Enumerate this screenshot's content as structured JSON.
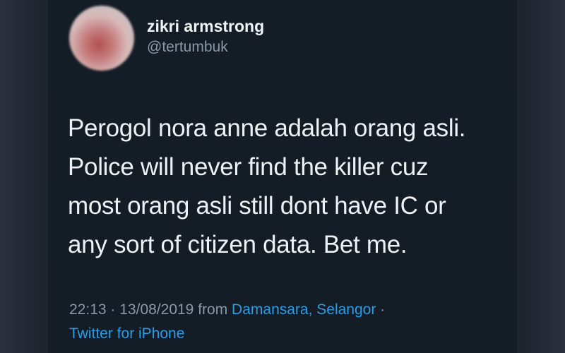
{
  "user": {
    "display_name": "zikri armstrong",
    "handle": "@tertumbuk"
  },
  "tweet": {
    "lines": [
      "Perogol nora anne adalah orang asli.",
      "Police will never find the killer cuz",
      "most orang asli still dont have IC or",
      "any sort of citizen data. Bet  me."
    ],
    "time": "22:13",
    "date": "13/08/2019",
    "from_text": "from",
    "location": "Damansara, Selangor",
    "client": "Twitter for iPhone",
    "separator": "·"
  },
  "colors": {
    "background": "#141c26",
    "text": "#eef1f4",
    "muted": "#8b98a5",
    "link": "#2c9de6"
  }
}
